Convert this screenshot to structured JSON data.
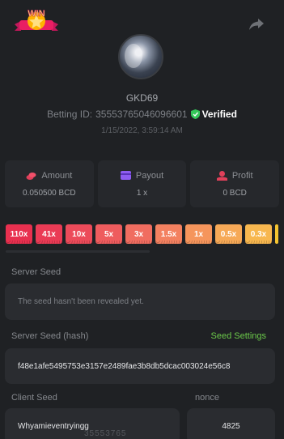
{
  "header": {
    "badge_text": "WIN",
    "username": "GKD69",
    "betting_label": "Betting ID:",
    "betting_id": "35553765046096601",
    "verified_label": "Verified",
    "date": "1/15/2022, 3:59:14 AM"
  },
  "stats": [
    {
      "label": "Amount",
      "value": "0.050500 BCD",
      "icon": "coins-icon"
    },
    {
      "label": "Payout",
      "value": "1 x",
      "icon": "wallet-icon"
    },
    {
      "label": "Profit",
      "value": "0 BCD",
      "icon": "profit-icon"
    }
  ],
  "multipliers": [
    {
      "label": "110x",
      "color": "#e8304f"
    },
    {
      "label": "41x",
      "color": "#ea3b55"
    },
    {
      "label": "10x",
      "color": "#ec4b5a"
    },
    {
      "label": "5x",
      "color": "#ee5c5e"
    },
    {
      "label": "3x",
      "color": "#f06d60"
    },
    {
      "label": "1.5x",
      "color": "#f38160"
    },
    {
      "label": "1x",
      "color": "#f5955c"
    },
    {
      "label": "0.5x",
      "color": "#f6a957"
    },
    {
      "label": "0.3x",
      "color": "#f7b74f"
    }
  ],
  "server_seed": {
    "label": "Server Seed",
    "value": "The seed hasn't been revealed yet."
  },
  "server_seed_hash": {
    "label": "Server Seed (hash)",
    "settings_label": "Seed Settings",
    "value": "f48e1afe5495753e3157e2489fae3b8db5dcac003024e56c8"
  },
  "client_seed": {
    "label": "Client Seed",
    "value": "Whyamieventryingg"
  },
  "nonce": {
    "label": "nonce",
    "value": "4825"
  },
  "bottom_fragment": "35553765"
}
